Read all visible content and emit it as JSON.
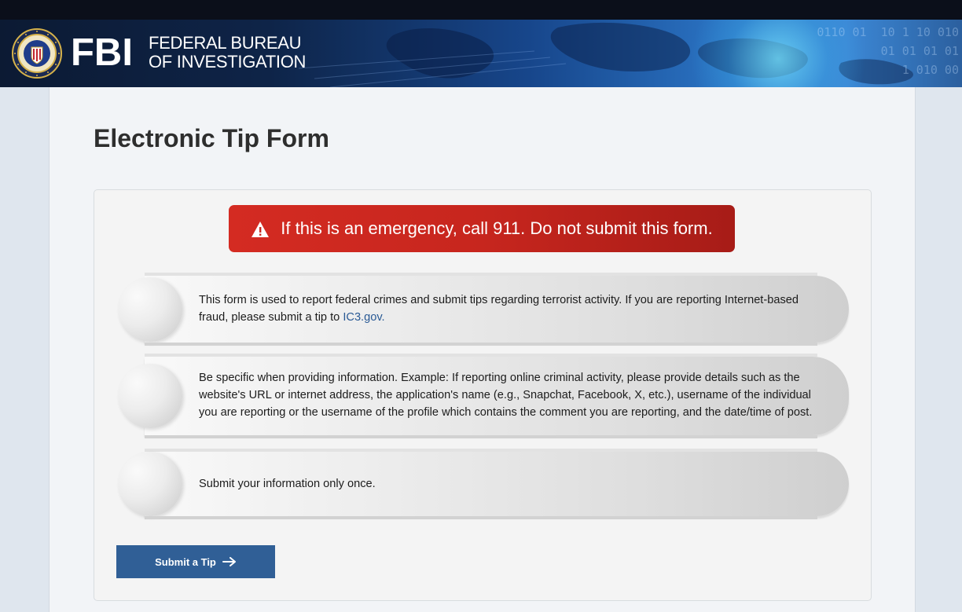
{
  "header": {
    "logo_word": "FBI",
    "logo_line1": "FEDERAL BUREAU",
    "logo_line2": "OF INVESTIGATION",
    "seal_icon": "fbi-seal-icon"
  },
  "page": {
    "title": "Electronic Tip Form"
  },
  "alert": {
    "icon": "warning-triangle-icon",
    "text": "If this is an emergency, call 911. Do not submit this form."
  },
  "info": [
    {
      "text": "This form is used to report federal crimes and submit tips regarding terrorist activity. If you are reporting Internet-based fraud, please submit a tip to ",
      "link": "IC3.gov."
    },
    {
      "text": "Be specific when providing information. Example: If reporting online criminal activity, please provide details such as the website's URL or internet address, the application's name (e.g., Snapchat, Facebook, X, etc.), username of the individual you are reporting or the username of the profile which contains the comment you are reporting, and the date/time of post."
    },
    {
      "text": "Submit your information only once."
    }
  ],
  "submit": {
    "label": "Submit a Tip",
    "icon": "arrow-right-icon"
  },
  "colors": {
    "alert_red": "#c7261e",
    "button_blue": "#305f96",
    "link_blue": "#2a5a95",
    "header_navy": "#0e2448"
  }
}
